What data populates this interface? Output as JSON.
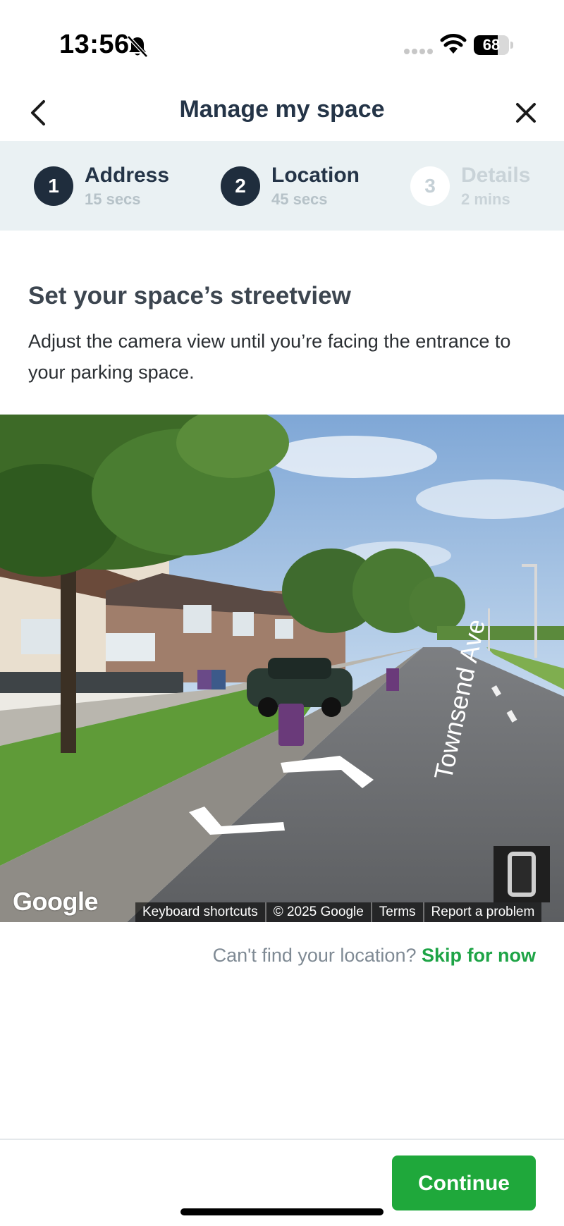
{
  "status_bar": {
    "time": "13:56",
    "battery": "68",
    "battery_fraction": 0.68,
    "icons": [
      "bell-muted-icon",
      "cellular-signal-icon",
      "wifi-icon",
      "battery-icon"
    ]
  },
  "header": {
    "title": "Manage my space",
    "back_icon": "chevron-left-icon",
    "close_icon": "close-icon"
  },
  "steps": [
    {
      "number": "1",
      "title": "Address",
      "subtitle": "15 secs",
      "state": "completed"
    },
    {
      "number": "2",
      "title": "Location",
      "subtitle": "45 secs",
      "state": "current"
    },
    {
      "number": "3",
      "title": "Details",
      "subtitle": "2 mins",
      "state": "upcoming"
    }
  ],
  "content": {
    "title": "Set your space’s streetview",
    "description": "Adjust the camera view until you’re facing the entrance to your parking space."
  },
  "streetview": {
    "logo": "Google",
    "street_label": "Townsend Ave",
    "attribution": [
      "Keyboard shortcuts",
      "© 2025 Google",
      "Terms",
      "Report a problem"
    ],
    "controls": [
      "phone-orientation-icon",
      "navigation-arrow-icon"
    ]
  },
  "skip": {
    "question": "Can't find your location?",
    "link": "Skip for now"
  },
  "footer": {
    "continue": "Continue"
  },
  "colors": {
    "accent_green": "#1fa83b",
    "navy": "#1f2d3d",
    "steps_background": "#eaf1f3"
  }
}
